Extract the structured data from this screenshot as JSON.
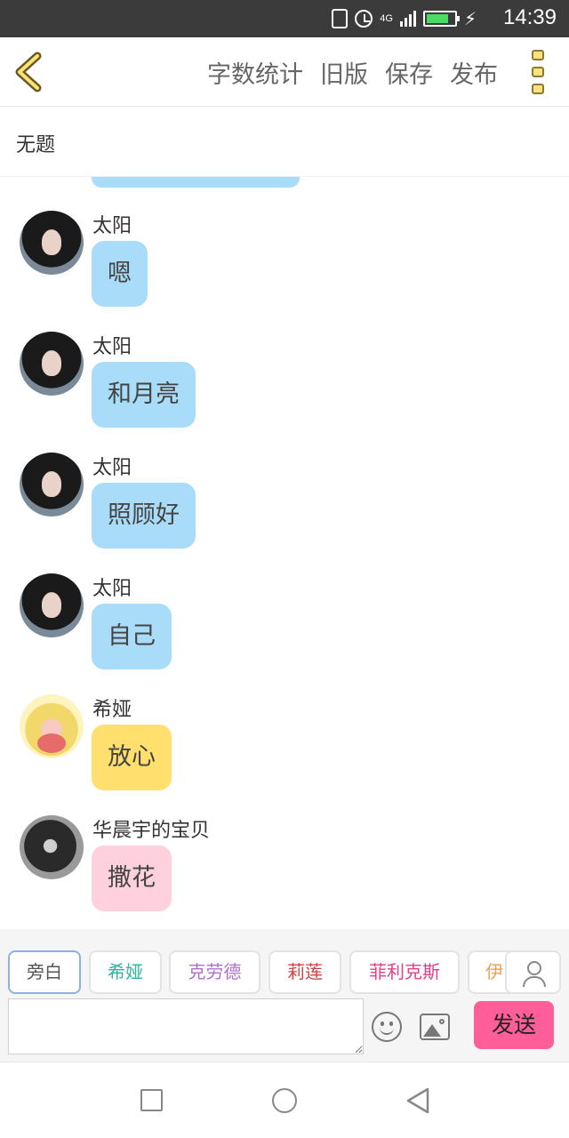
{
  "status_bar": {
    "network": "4G",
    "time": "14:39",
    "battery_level": 0.8,
    "signal_bars": 4
  },
  "toolbar": {
    "actions": [
      "字数统计",
      "旧版",
      "保存",
      "发布"
    ]
  },
  "title": "无题",
  "messages": [
    {
      "sender": "太阳",
      "text": "嗯",
      "avatar": "dark",
      "bubble": "blue"
    },
    {
      "sender": "太阳",
      "text": "和月亮",
      "avatar": "dark",
      "bubble": "blue"
    },
    {
      "sender": "太阳",
      "text": "照顾好",
      "avatar": "dark",
      "bubble": "blue"
    },
    {
      "sender": "太阳",
      "text": "自己",
      "avatar": "dark",
      "bubble": "blue"
    },
    {
      "sender": "希娅",
      "text": "放心",
      "avatar": "gold",
      "bubble": "yellow"
    },
    {
      "sender": "华晨宇的宝贝",
      "text": "撒花",
      "avatar": "bw",
      "bubble": "pink"
    }
  ],
  "characters": [
    {
      "name": "旁白",
      "color": "#555555",
      "active": true
    },
    {
      "name": "希娅",
      "color": "#2bb3a3",
      "active": false
    },
    {
      "name": "克劳德",
      "color": "#b070d0",
      "active": false
    },
    {
      "name": "莉莲",
      "color": "#d04040",
      "active": false
    },
    {
      "name": "菲利克斯",
      "color": "#e0408a",
      "active": false
    },
    {
      "name": "伊",
      "color": "#f0a050",
      "active": false
    }
  ],
  "input": {
    "value": "",
    "placeholder": ""
  },
  "send_label": "发送",
  "colors": {
    "bubble_blue": "#a8dcf8",
    "bubble_yellow": "#ffdf6e",
    "bubble_pink": "#ffd0de",
    "send_button": "#ff5e98",
    "accent_gold": "#ffe27a"
  },
  "icons": [
    "vibrate-icon",
    "alarm-icon",
    "signal-icon",
    "battery-icon",
    "charging-icon",
    "back-arrow-icon",
    "more-menu-icon",
    "emoji-icon",
    "image-icon",
    "person-icon",
    "nav-recent-icon",
    "nav-home-icon",
    "nav-back-icon"
  ]
}
